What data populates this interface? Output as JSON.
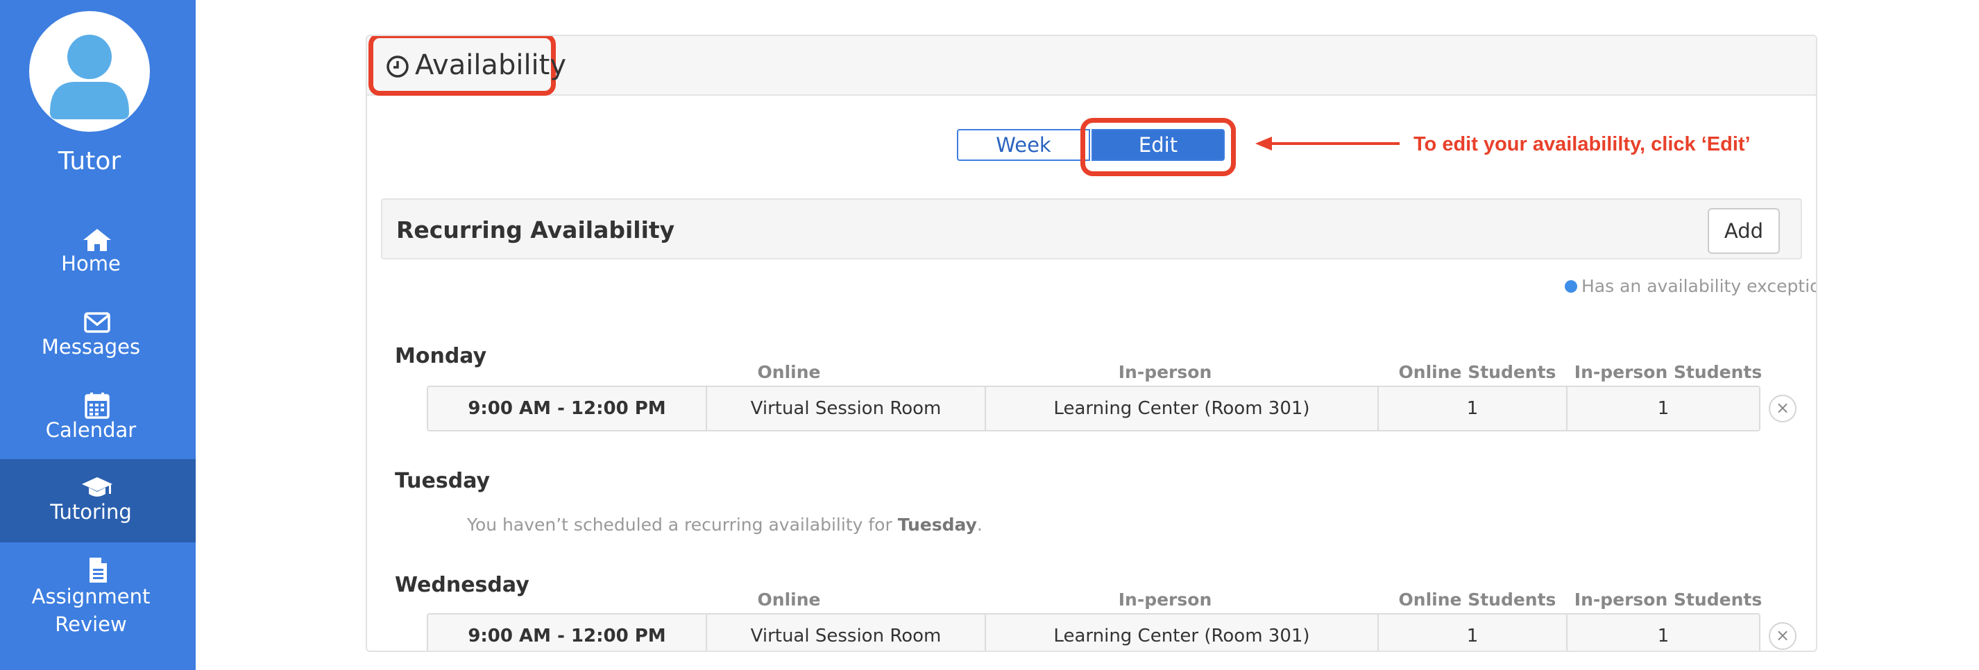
{
  "sidebar": {
    "role": "Tutor",
    "items": [
      {
        "label": "Home",
        "icon": "home-icon"
      },
      {
        "label": "Messages",
        "icon": "envelope-icon"
      },
      {
        "label": "Calendar",
        "icon": "calendar-icon"
      },
      {
        "label": "Tutoring",
        "icon": "graduation-cap-icon",
        "active": true
      },
      {
        "label": "Assignment Review",
        "icon": "document-icon"
      }
    ]
  },
  "card": {
    "title": "Availability",
    "toggle": {
      "week": "Week",
      "edit": "Edit"
    },
    "annotation": "To edit your availabililty, click ‘Edit’"
  },
  "recurring": {
    "title": "Recurring Availability",
    "add_label": "Add",
    "legend": "Has an availability exception",
    "columns": {
      "online": "Online",
      "in_person": "In-person",
      "online_students": "Online Students",
      "in_person_students": "In-person Students"
    },
    "days": [
      {
        "name": "Monday",
        "slots": [
          {
            "time": "9:00 AM - 12:00 PM",
            "online": "Virtual Session Room",
            "in_person": "Learning Center (Room 301)",
            "online_students": "1",
            "in_person_students": "1"
          }
        ]
      },
      {
        "name": "Tuesday",
        "empty_prefix": "You haven’t scheduled a recurring availability for ",
        "empty_day": "Tuesday",
        "empty_suffix": "."
      },
      {
        "name": "Wednesday",
        "slots": [
          {
            "time": "9:00 AM - 12:00 PM",
            "online": "Virtual Session Room",
            "in_person": "Learning Center (Room 301)",
            "online_students": "1",
            "in_person_students": "1"
          }
        ]
      }
    ]
  },
  "colors": {
    "sidebar": "#3d7ee0",
    "sidebar_active": "#2a5fae",
    "annotation": "#e8402a",
    "primary": "#3575d6"
  }
}
